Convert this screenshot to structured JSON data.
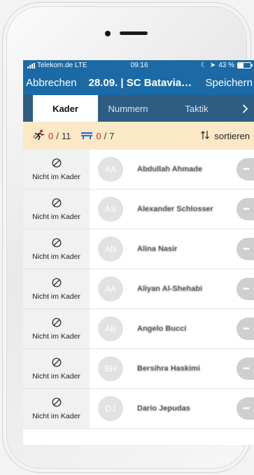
{
  "status_bar": {
    "carrier": "Telekom.de LTE",
    "time": "09:16",
    "battery": "43 %",
    "battery_level": 0.43
  },
  "header": {
    "cancel_label": "Abbrechen",
    "title": "28.09. | SC Batavia 7...",
    "save_label": "Speichern"
  },
  "tabs": [
    {
      "label": "Kader",
      "active": true
    },
    {
      "label": "Nummern",
      "active": false
    },
    {
      "label": "Taktik",
      "active": false
    }
  ],
  "counts": {
    "field_current": "0",
    "field_total": "11",
    "bench_current": "0",
    "bench_total": "7",
    "sort_label": "sortieren"
  },
  "players": [
    {
      "initials": "AA",
      "name": "Abdullah Ahmade",
      "status": "Nicht im Kader"
    },
    {
      "initials": "AS",
      "name": "Alexander Schlosser",
      "status": "Nicht im Kader"
    },
    {
      "initials": "AN",
      "name": "Alina Nasir",
      "status": "Nicht im Kader"
    },
    {
      "initials": "AA",
      "name": "Aliyan Al-Shehabi",
      "status": "Nicht im Kader"
    },
    {
      "initials": "AB",
      "name": "Angelo Bucci",
      "status": "Nicht im Kader"
    },
    {
      "initials": "BH",
      "name": "Bersihra Haskimi",
      "status": "Nicht im Kader"
    },
    {
      "initials": "DJ",
      "name": "Dario Jepudas",
      "status": "Nicht im Kader"
    }
  ],
  "colors": {
    "navbar": "#1b6aa5",
    "tabbar": "#2d5d82",
    "countbar": "#fbe9c6",
    "count_red": "#e02020",
    "count_blue": "#2b6fd6"
  }
}
